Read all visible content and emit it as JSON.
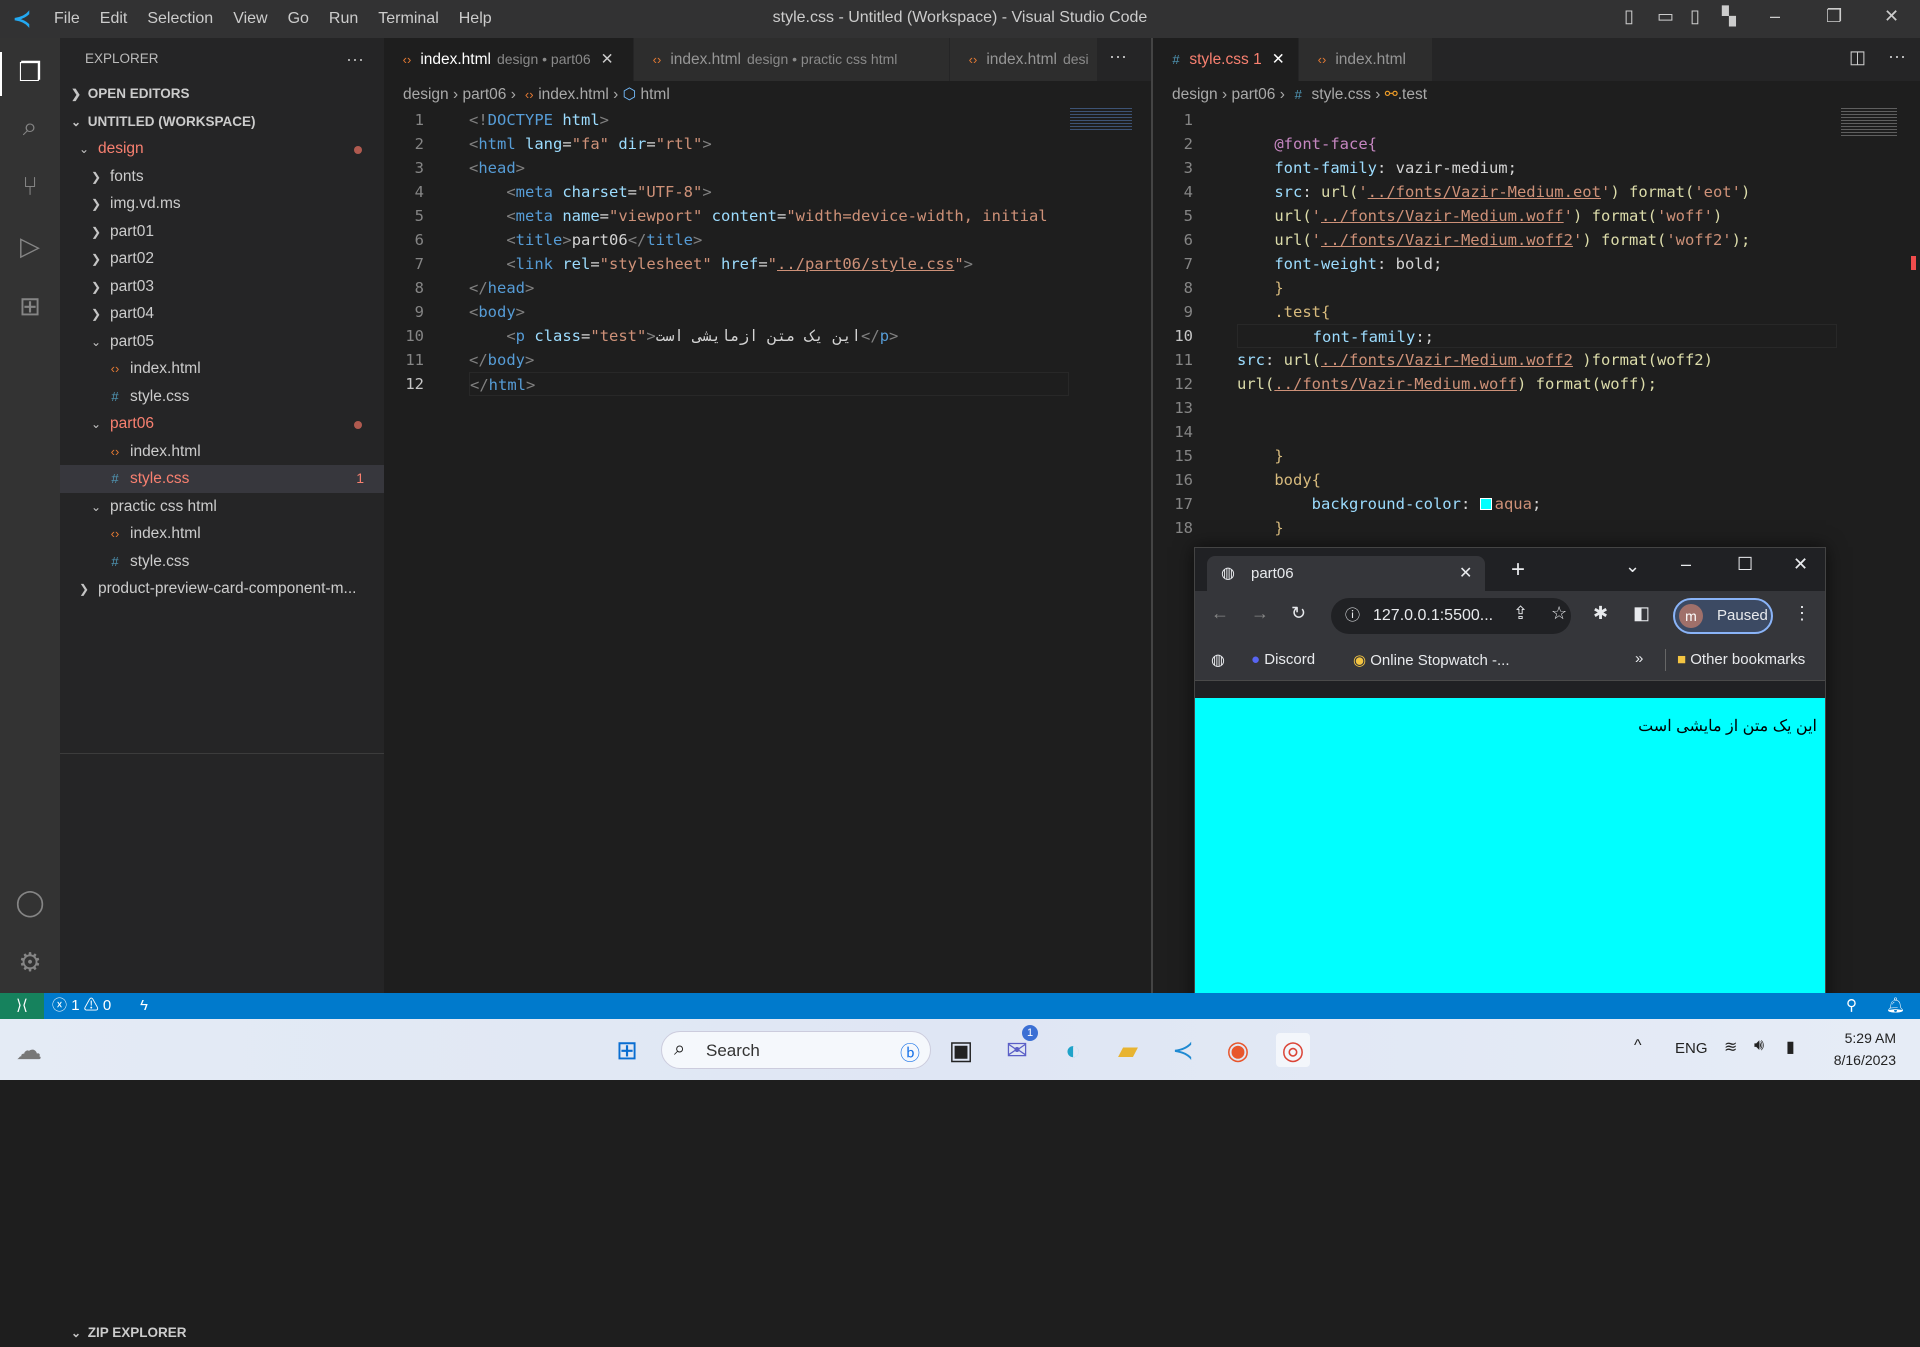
{
  "titlebar": {
    "menus": [
      "File",
      "Edit",
      "Selection",
      "View",
      "Go",
      "Run",
      "Terminal",
      "Help"
    ],
    "title": "style.css - Untitled (Workspace) - Visual Studio Code"
  },
  "sidebar": {
    "header": "EXPLORER",
    "open_editors": "OPEN EDITORS",
    "workspace": "UNTITLED (WORKSPACE)",
    "zip": "ZIP EXPLORER",
    "tree": [
      {
        "label": "design",
        "depth": 1,
        "type": "folder",
        "open": true,
        "error": true,
        "dot": true
      },
      {
        "label": "fonts",
        "depth": 2,
        "type": "folder",
        "open": false
      },
      {
        "label": "img.vd.ms",
        "depth": 2,
        "type": "folder",
        "open": false
      },
      {
        "label": "part01",
        "depth": 2,
        "type": "folder",
        "open": false
      },
      {
        "label": "part02",
        "depth": 2,
        "type": "folder",
        "open": false
      },
      {
        "label": "part03",
        "depth": 2,
        "type": "folder",
        "open": false
      },
      {
        "label": "part04",
        "depth": 2,
        "type": "folder",
        "open": false
      },
      {
        "label": "part05",
        "depth": 2,
        "type": "folder",
        "open": true
      },
      {
        "label": "index.html",
        "depth": 3,
        "type": "html"
      },
      {
        "label": "style.css",
        "depth": 3,
        "type": "css"
      },
      {
        "label": "part06",
        "depth": 2,
        "type": "folder",
        "open": true,
        "error": true,
        "dot": true
      },
      {
        "label": "index.html",
        "depth": 3,
        "type": "html"
      },
      {
        "label": "style.css",
        "depth": 3,
        "type": "css",
        "error": true,
        "selected": true,
        "badge": "1"
      },
      {
        "label": "practic css html",
        "depth": 2,
        "type": "folder",
        "open": true
      },
      {
        "label": "index.html",
        "depth": 3,
        "type": "html"
      },
      {
        "label": "style.css",
        "depth": 3,
        "type": "css"
      },
      {
        "label": "product-preview-card-component-m...",
        "depth": 1,
        "type": "folder",
        "open": false
      }
    ]
  },
  "left_editor": {
    "tabs": [
      {
        "label": "index.html",
        "desc": "design • part06",
        "active": true
      },
      {
        "label": "index.html",
        "desc": "design • practic css html"
      },
      {
        "label": "index.html",
        "desc": "desi"
      }
    ],
    "breadcrumb": [
      "design",
      "part06",
      "index.html",
      "html"
    ],
    "current_line": 12,
    "lines": [
      [
        [
          "<!",
          "t-br"
        ],
        [
          "DOCTYPE",
          "t-tag"
        ],
        [
          " html",
          "t-attr"
        ],
        [
          ">",
          "t-br"
        ]
      ],
      [
        [
          "<",
          "t-br"
        ],
        [
          "html",
          "t-tag"
        ],
        [
          " lang",
          "t-attr"
        ],
        [
          "=",
          "t-txt"
        ],
        [
          "\"fa\"",
          "t-str"
        ],
        [
          " dir",
          "t-attr"
        ],
        [
          "=",
          "t-txt"
        ],
        [
          "\"rtl\"",
          "t-str"
        ],
        [
          ">",
          "t-br"
        ]
      ],
      [
        [
          "<",
          "t-br"
        ],
        [
          "head",
          "t-tag"
        ],
        [
          ">",
          "t-br"
        ]
      ],
      [
        [
          "    <",
          "t-br"
        ],
        [
          "meta",
          "t-tag"
        ],
        [
          " charset",
          "t-attr"
        ],
        [
          "=",
          "t-txt"
        ],
        [
          "\"UTF-8\"",
          "t-str"
        ],
        [
          ">",
          "t-br"
        ]
      ],
      [
        [
          "    <",
          "t-br"
        ],
        [
          "meta",
          "t-tag"
        ],
        [
          " name",
          "t-attr"
        ],
        [
          "=",
          "t-txt"
        ],
        [
          "\"viewport\"",
          "t-str"
        ],
        [
          " content",
          "t-attr"
        ],
        [
          "=",
          "t-txt"
        ],
        [
          "\"width=device-width, initial",
          "t-str"
        ]
      ],
      [
        [
          "    <",
          "t-br"
        ],
        [
          "title",
          "t-tag"
        ],
        [
          ">",
          "t-br"
        ],
        [
          "part06",
          "t-txt"
        ],
        [
          "</",
          "t-br"
        ],
        [
          "title",
          "t-tag"
        ],
        [
          ">",
          "t-br"
        ]
      ],
      [
        [
          "    <",
          "t-br"
        ],
        [
          "link",
          "t-tag"
        ],
        [
          " rel",
          "t-attr"
        ],
        [
          "=",
          "t-txt"
        ],
        [
          "\"stylesheet\"",
          "t-str"
        ],
        [
          " href",
          "t-attr"
        ],
        [
          "=",
          "t-txt"
        ],
        [
          "\"",
          "t-str"
        ],
        [
          "../part06/style.css",
          "t-url"
        ],
        [
          "\"",
          "t-str"
        ],
        [
          ">",
          "t-br"
        ]
      ],
      [
        [
          "</",
          "t-br"
        ],
        [
          "head",
          "t-tag"
        ],
        [
          ">",
          "t-br"
        ]
      ],
      [
        [
          "<",
          "t-br"
        ],
        [
          "body",
          "t-tag"
        ],
        [
          ">",
          "t-br"
        ]
      ],
      [
        [
          "    <",
          "t-br"
        ],
        [
          "p",
          "t-tag"
        ],
        [
          " class",
          "t-attr"
        ],
        [
          "=",
          "t-txt"
        ],
        [
          "\"test\"",
          "t-str"
        ],
        [
          ">",
          "t-br"
        ],
        [
          "این یک متن ازمایشی است",
          "t-txt"
        ],
        [
          "</",
          "t-br"
        ],
        [
          "p",
          "t-tag"
        ],
        [
          ">",
          "t-br"
        ]
      ],
      [
        [
          "</",
          "t-br"
        ],
        [
          "body",
          "t-tag"
        ],
        [
          ">",
          "t-br"
        ]
      ],
      [
        [
          "</",
          "t-br"
        ],
        [
          "html",
          "t-tag"
        ],
        [
          ">",
          "t-br"
        ]
      ]
    ]
  },
  "right_editor": {
    "tabs": [
      {
        "label": "style.css",
        "badge": "1",
        "active": true,
        "error": true
      },
      {
        "label": "index.html"
      }
    ],
    "breadcrumb": [
      "design",
      "part06",
      "style.css",
      ".test"
    ],
    "current_line": 10,
    "lines": [
      [],
      [
        [
          "    @font-face{",
          "t-at"
        ]
      ],
      [
        [
          "    font-family",
          "t-prop"
        ],
        [
          ": vazir-medium;",
          "t-txt"
        ]
      ],
      [
        [
          "    src",
          "t-prop"
        ],
        [
          ": ",
          "t-txt"
        ],
        [
          "url(",
          "t-fn"
        ],
        [
          "'",
          "t-str"
        ],
        [
          "../fonts/Vazir-Medium.eot",
          "t-url"
        ],
        [
          "'",
          "t-str"
        ],
        [
          ")",
          "t-fn"
        ],
        [
          " format(",
          "t-fn"
        ],
        [
          "'eot'",
          "t-str"
        ],
        [
          ")",
          "t-fn"
        ]
      ],
      [
        [
          "    url(",
          "t-fn"
        ],
        [
          "'",
          "t-str"
        ],
        [
          "../fonts/Vazir-Medium.woff",
          "t-url"
        ],
        [
          "'",
          "t-str"
        ],
        [
          ")",
          "t-fn"
        ],
        [
          " format(",
          "t-fn"
        ],
        [
          "'woff'",
          "t-str"
        ],
        [
          ")",
          "t-fn"
        ]
      ],
      [
        [
          "    url(",
          "t-fn"
        ],
        [
          "'",
          "t-str"
        ],
        [
          "../fonts/Vazir-Medium.woff2",
          "t-url"
        ],
        [
          "'",
          "t-str"
        ],
        [
          ")",
          "t-fn"
        ],
        [
          " format(",
          "t-fn"
        ],
        [
          "'woff2'",
          "t-str"
        ],
        [
          ");",
          "t-fn"
        ]
      ],
      [
        [
          "    font-weight",
          "t-prop"
        ],
        [
          ": bold;",
          "t-txt"
        ]
      ],
      [
        [
          "    }",
          "t-sel"
        ]
      ],
      [
        [
          "    .test{",
          "t-sel"
        ]
      ],
      [
        [
          "        font-family",
          "t-prop"
        ],
        [
          ":;",
          "t-txt"
        ]
      ],
      [
        [
          "src",
          "t-prop"
        ],
        [
          ": ",
          "t-txt"
        ],
        [
          "url(",
          "t-fn"
        ],
        [
          "../fonts/Vazir-Medium.woff2",
          "t-url"
        ],
        [
          " )format(woff2)",
          "t-fn"
        ]
      ],
      [
        [
          "url(",
          "t-fn"
        ],
        [
          "../fonts/Vazir-Medium.woff",
          "t-url"
        ],
        [
          ") format(woff);",
          "t-fn"
        ]
      ],
      [],
      [],
      [
        [
          "    }",
          "t-sel"
        ]
      ],
      [
        [
          "    body{",
          "t-sel"
        ]
      ],
      [
        [
          "        background-color",
          "t-prop"
        ],
        [
          ": ",
          "t-txt"
        ],
        [
          "",
          "t-swatch"
        ],
        [
          "aqua",
          "t-str"
        ],
        [
          ";",
          "t-txt"
        ]
      ],
      [
        [
          "    }",
          "t-sel"
        ]
      ]
    ]
  },
  "browser": {
    "tab_title": "part06",
    "url": "127.0.0.1:5500...",
    "profile_initial": "m",
    "profile_status": "Paused",
    "bookmarks": [
      "Discord",
      "Online Stopwatch -..."
    ],
    "more": "»",
    "other_bookmarks": "Other bookmarks",
    "page_text": "این یک متن از مایشی است",
    "page_bg": "#00ffff"
  },
  "statusbar": {
    "errors": "1",
    "warnings": "0"
  },
  "taskbar": {
    "search": "Search",
    "chat_badge": "1",
    "lang": "ENG",
    "time": "5:29 AM",
    "date": "8/16/2023"
  },
  "colors": {
    "accent": "#007acc",
    "error": "#f88070"
  }
}
